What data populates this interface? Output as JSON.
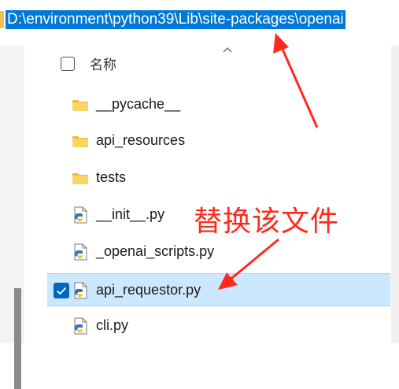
{
  "address_bar": {
    "path": "D:\\environment\\python39\\Lib\\site-packages\\openai"
  },
  "column_header": {
    "name_label": "名称"
  },
  "files": [
    {
      "name": "__pycache__",
      "type": "folder",
      "selected": false
    },
    {
      "name": "api_resources",
      "type": "folder",
      "selected": false
    },
    {
      "name": "tests",
      "type": "folder",
      "selected": false
    },
    {
      "name": "__init__.py",
      "type": "python-file",
      "selected": false
    },
    {
      "name": "_openai_scripts.py",
      "type": "python-file",
      "selected": false
    },
    {
      "name": "api_requestor.py",
      "type": "python-file",
      "selected": true
    },
    {
      "name": "cli.py",
      "type": "python-file",
      "selected": false
    }
  ],
  "annotation": {
    "text": "替换该文件",
    "color": "#ff2a1a"
  },
  "colors": {
    "selection": "#cce8ff",
    "address_highlight": "#0078d7",
    "checkbox": "#0067c0",
    "folder": "#f4c84a"
  }
}
